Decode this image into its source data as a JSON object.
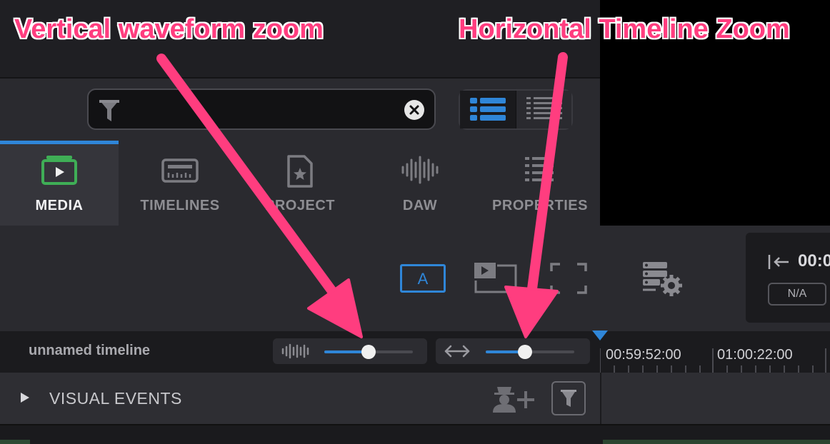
{
  "annotations": {
    "left": "Vertical waveform zoom",
    "right": "Horizontal Timeline Zoom"
  },
  "search": {
    "value": "",
    "placeholder": ""
  },
  "view_toggle": {
    "active": "list"
  },
  "tabs": [
    {
      "label": "MEDIA",
      "icon": "media-icon",
      "active": true
    },
    {
      "label": "TIMELINES",
      "icon": "timelines-icon",
      "active": false
    },
    {
      "label": "PROJECT",
      "icon": "project-icon",
      "active": false
    },
    {
      "label": "DAW",
      "icon": "waveform-icon",
      "active": false
    },
    {
      "label": "PROPERTIES",
      "icon": "properties-icon",
      "active": false
    }
  ],
  "viewer_toolbar": {
    "audio_mode_label": "A",
    "timecode": "00:0",
    "timecode_status": "N/A"
  },
  "timeline": {
    "name": "unnamed timeline",
    "vertical_zoom_fraction": 0.5,
    "horizontal_zoom_fraction": 0.44,
    "ruler_labels": [
      "00:59:52:00",
      "01:00:22:00"
    ]
  },
  "visual_events": {
    "label": "VISUAL EVENTS"
  },
  "colors": {
    "accent": "#2f86d8",
    "annotation": "#ff3d7f",
    "media_green": "#3fae56"
  }
}
